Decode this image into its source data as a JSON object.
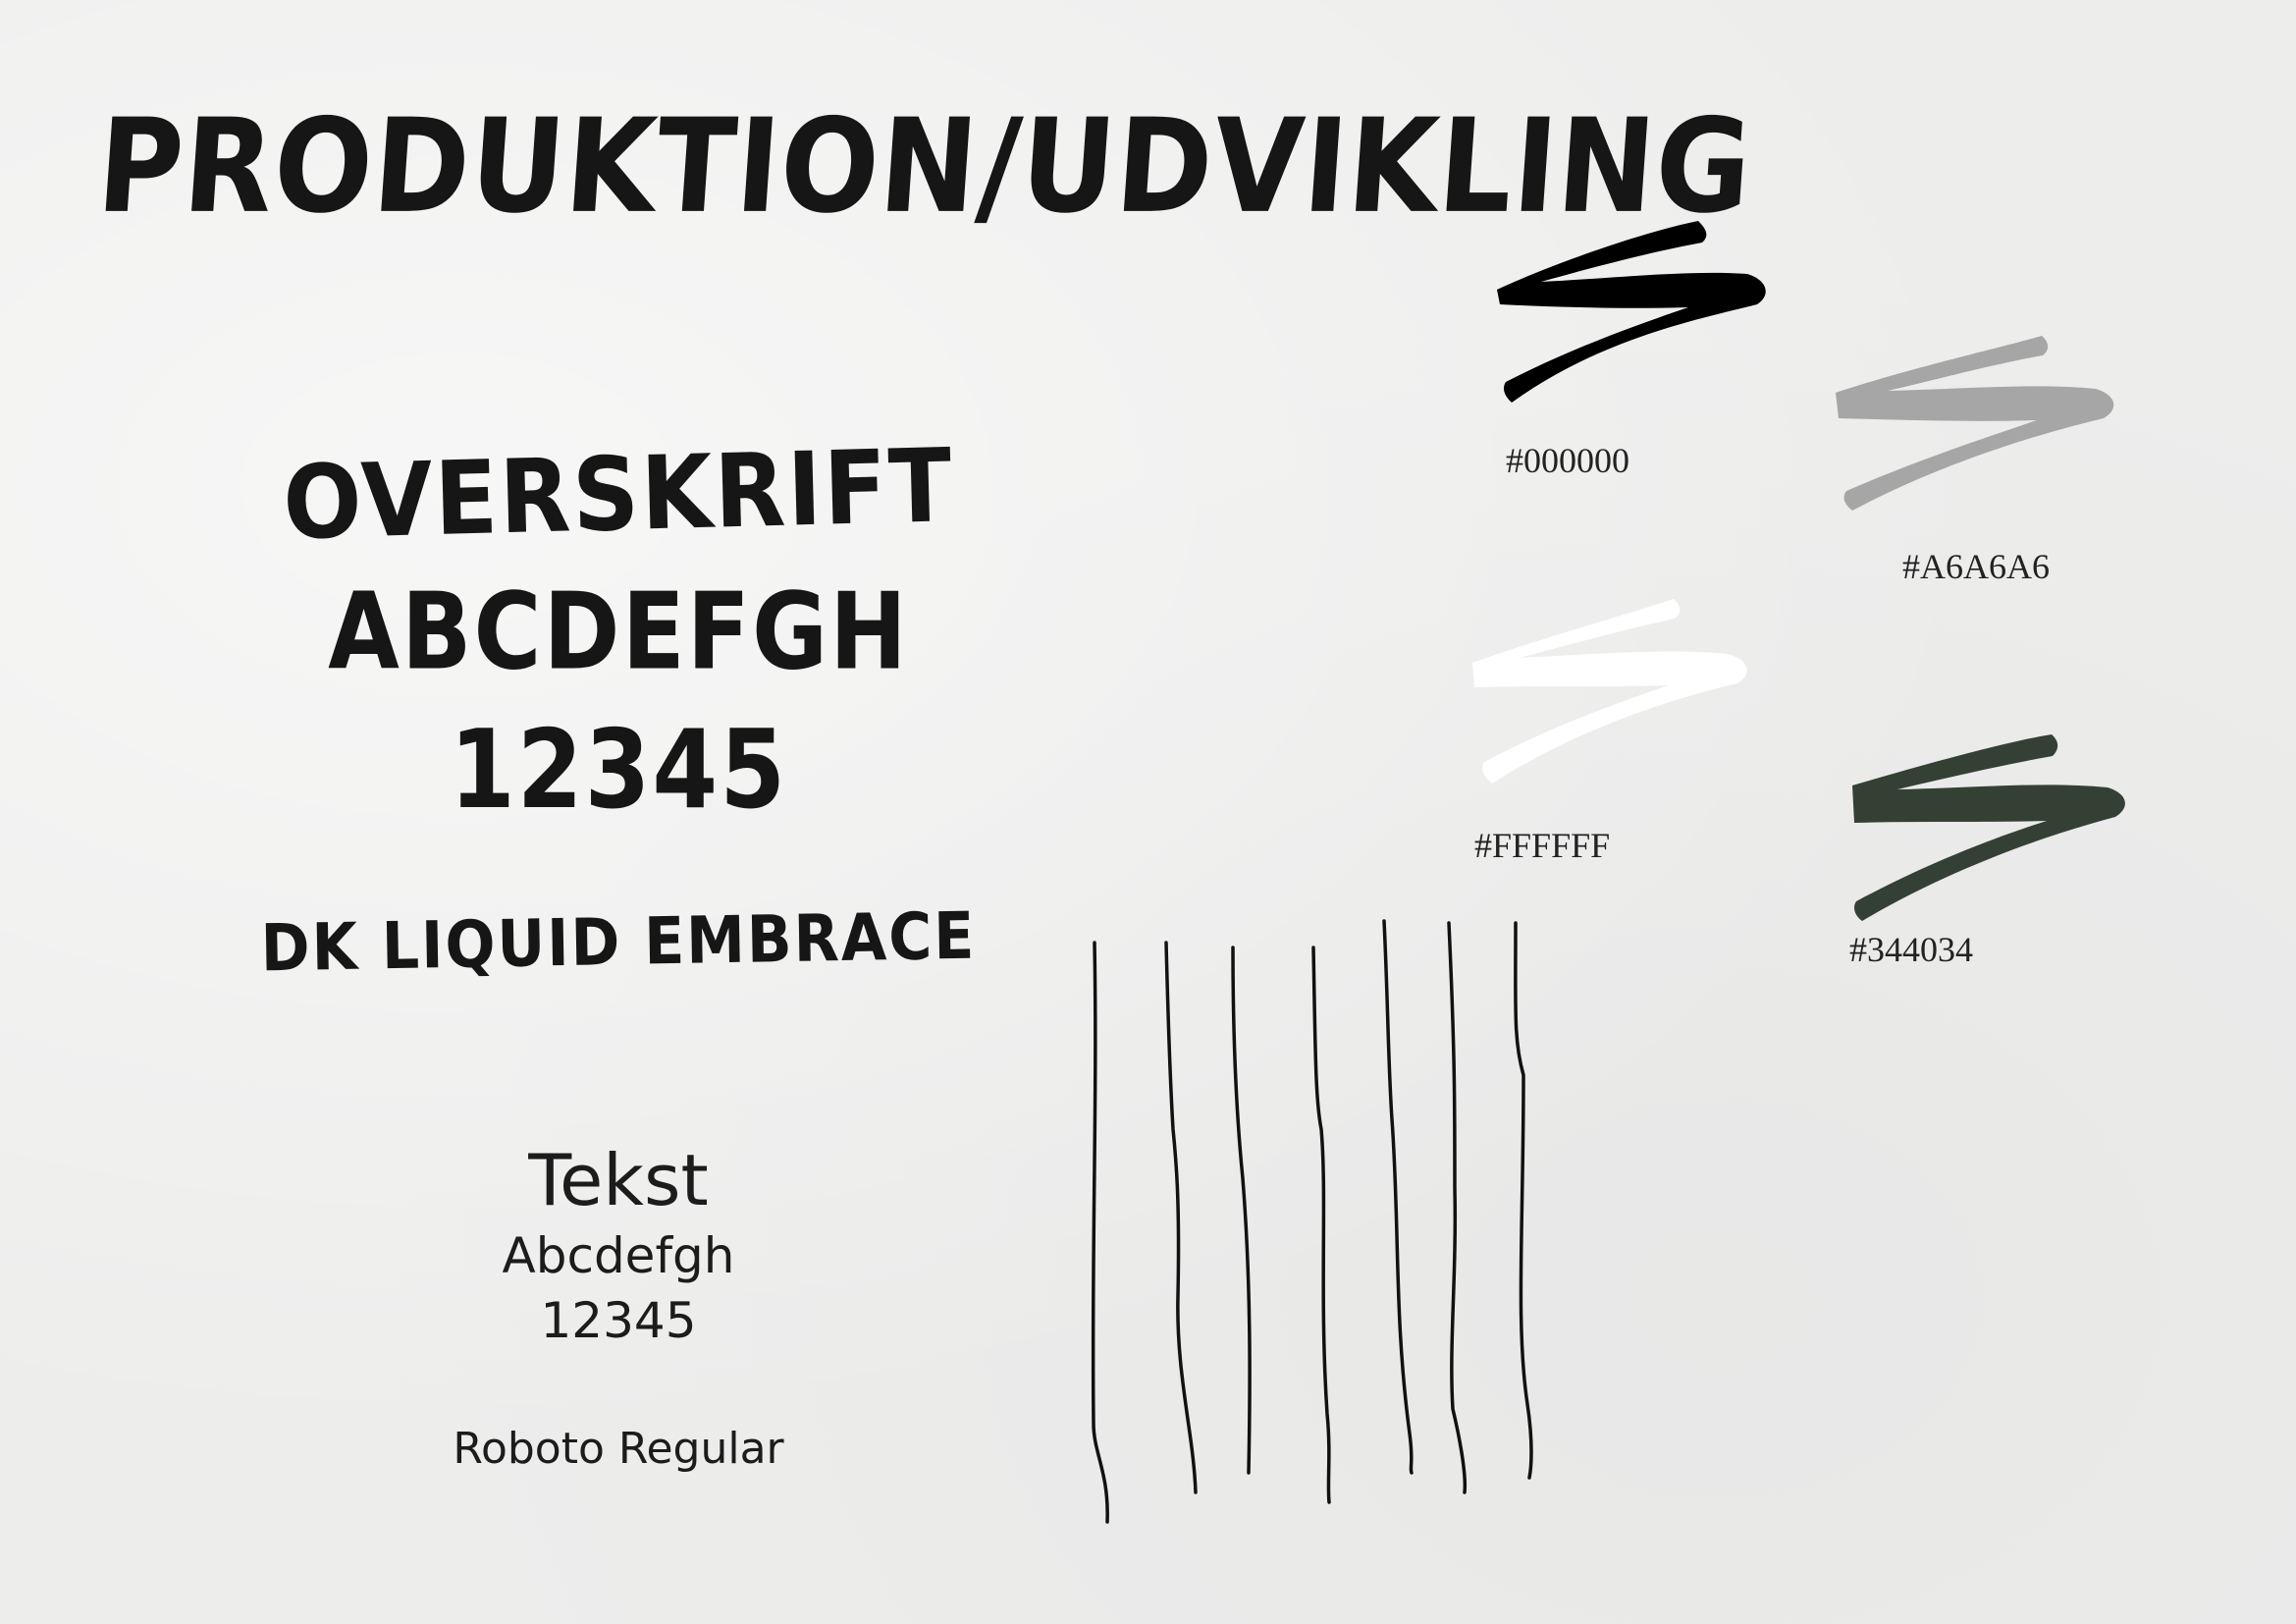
{
  "title": "PRODUKTION/UDVIKLING",
  "heading_font": {
    "sample_word": "OVERSKRIFT",
    "sample_letters": "ABCDEFGH",
    "sample_digits": "12345",
    "font_name": "DK LIQUID EMBRACE"
  },
  "text_font": {
    "sample_word": "Tekst",
    "sample_letters": "Abcdefgh",
    "sample_digits": "12345",
    "font_name": "Roboto Regular"
  },
  "swatches": [
    {
      "hex": "#000000",
      "color": "#000000"
    },
    {
      "hex": "#A6A6A6",
      "color": "#A6A6A6"
    },
    {
      "hex": "#FFFFFF",
      "color": "#FFFFFF"
    },
    {
      "hex": "#344034",
      "color": "#344034"
    }
  ]
}
